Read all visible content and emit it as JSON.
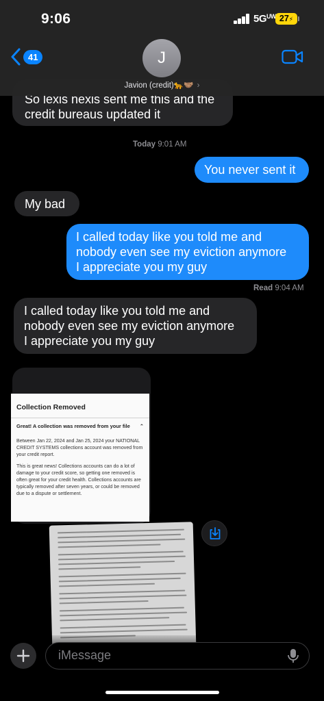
{
  "status": {
    "time": "9:06",
    "network": "5G",
    "network_suffix": "UW",
    "battery": "27"
  },
  "header": {
    "back_count": "41",
    "avatar_initial": "J",
    "contact_name": "Javion (credit)🐆🤝🏽",
    "chevron": "›"
  },
  "messages": {
    "m1": [
      "So lexis nexis sent me this and the",
      "credit bureaus updated it"
    ],
    "timestamp_day": "Today",
    "timestamp_time": "9:01 AM",
    "m2": "You never sent it",
    "m3": "My bad",
    "m4": [
      "I called today like you told me and",
      "nobody even see my eviction anymore",
      "I appreciate you my guy"
    ],
    "read_label": "Read",
    "read_time": "9:04 AM",
    "m5": [
      "I called today like you told me and",
      "nobody even see my eviction anymore",
      "I appreciate you my guy"
    ]
  },
  "attachment": {
    "title": "Collection Removed",
    "subtitle": "Great! A collection was removed from your file",
    "para1": "Between Jan 22, 2024 and Jan 25, 2024 your NATIONAL CREDIT SYSTEMS collections account was removed from your credit report.",
    "para2": "This is great news! Collections accounts can do a lot of damage to your credit score, so getting one removed is often great for your credit health. Collections accounts are typically removed after seven years, or could be removed due to a dispute or settlement."
  },
  "input": {
    "placeholder": "iMessage"
  },
  "colors": {
    "outgoing": "#1e8bfb",
    "incoming": "#262628",
    "accent": "#0a84ff",
    "battery": "#ffd60a"
  }
}
